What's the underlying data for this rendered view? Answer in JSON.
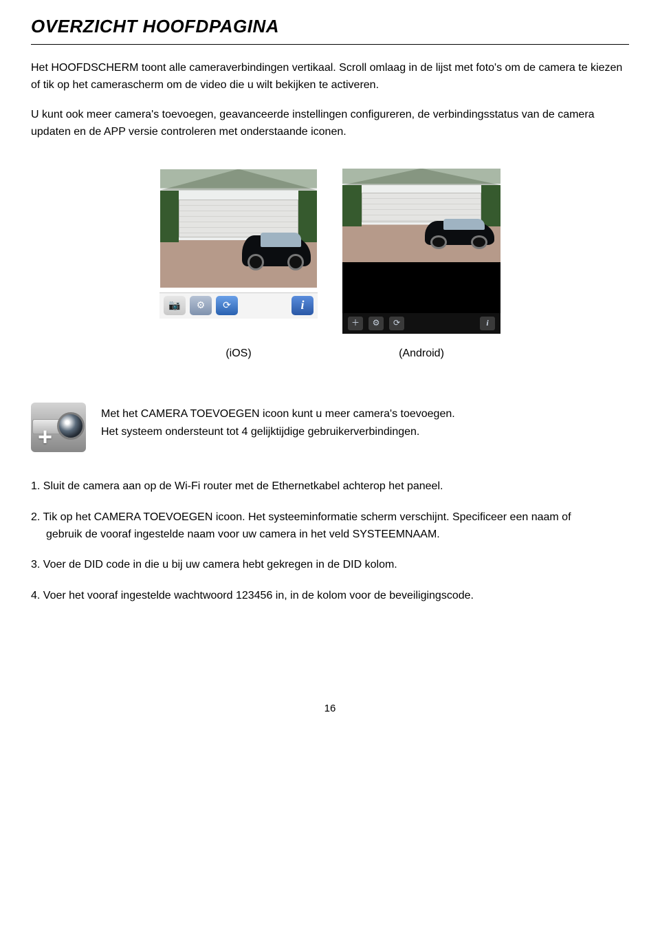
{
  "heading": "OVERZICHT HOOFDPAGINA",
  "intro1": "Het HOOFDSCHERM toont alle cameraverbindingen vertikaal. Scroll omlaag in de lijst met foto's om de camera te kiezen of tik op het camerascherm om de video die u wilt bekijken te activeren.",
  "intro2": "U kunt ook meer camera's toevoegen, geavanceerde instellingen configureren, de verbindingsstatus van de camera updaten en de APP versie controleren met onderstaande iconen.",
  "captions": {
    "ios": "(iOS)",
    "android": "(Android)"
  },
  "addCamera": {
    "line1": "Met het CAMERA TOEVOEGEN icoon kunt u meer camera's toevoegen.",
    "line2": "Het systeem ondersteunt tot 4 gelijktijdige gebruikerverbindingen."
  },
  "steps": {
    "s1": "1. Sluit de camera aan op de Wi-Fi router met de Ethernetkabel achterop het paneel.",
    "s2a": "2. Tik op het CAMERA TOEVOEGEN icoon. Het systeeminformatie scherm verschijnt. Specificeer een naam of",
    "s2b": "gebruik de vooraf ingestelde naam voor uw camera in het veld SYSTEEMNAAM.",
    "s3": "3. Voer de DID code in die u bij uw camera hebt gekregen in de DID kolom.",
    "s4": "4. Voer het vooraf ingestelde wachtwoord 123456 in, in de kolom voor de beveiligingscode."
  },
  "pageNumber": "16"
}
